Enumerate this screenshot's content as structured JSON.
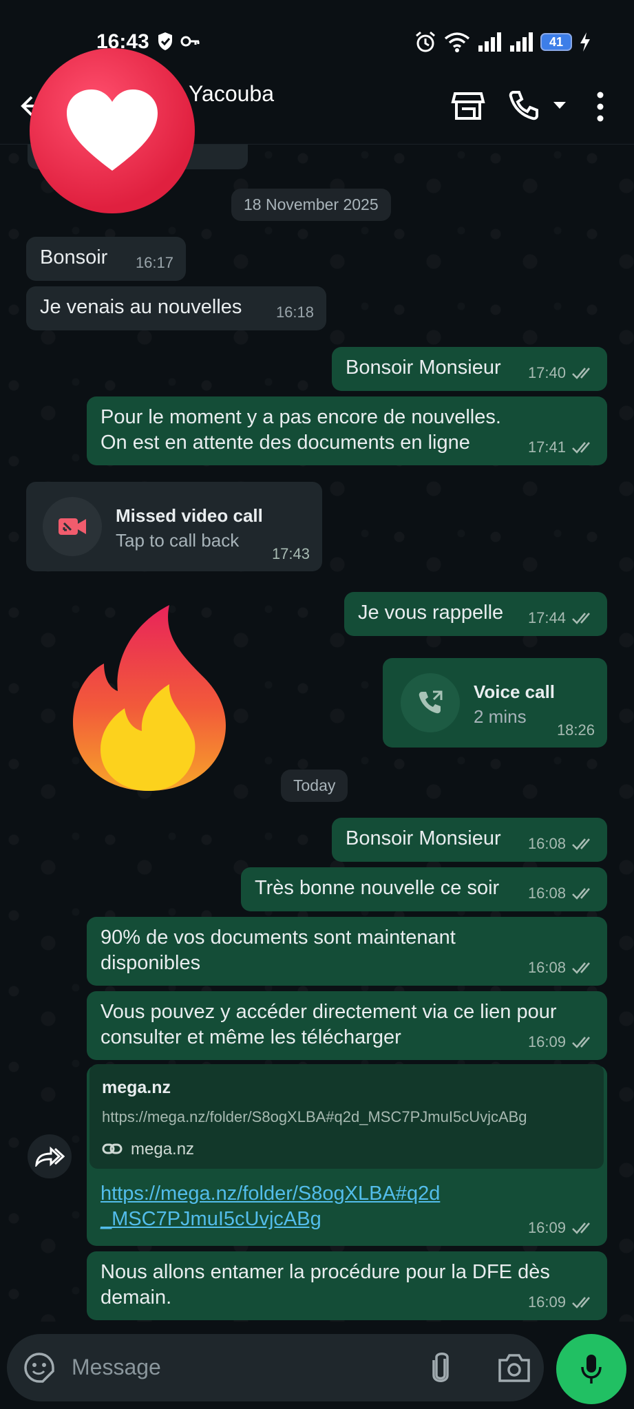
{
  "status": {
    "time": "16:43",
    "battery": "41"
  },
  "header": {
    "contact_name": "Fando Yacouba"
  },
  "chat": {
    "date1": "18 November 2025",
    "date2": "Today",
    "messages": [
      {
        "text": "Bonsoir",
        "time": "16:17"
      },
      {
        "text": "Je venais au nouvelles",
        "time": "16:18"
      },
      {
        "text": "Bonsoir Monsieur",
        "time": "17:40"
      },
      {
        "text": "Pour le moment y a pas encore de nouvelles. On est en attente des documents en ligne",
        "time": "17:41"
      },
      {
        "title": "Missed video call",
        "sub": "Tap to call back",
        "time": "17:43"
      },
      {
        "text": "Je vous rappelle",
        "time": "17:44"
      },
      {
        "title": "Voice call",
        "sub": "2 mins",
        "time": "18:26"
      },
      {
        "text": "Bonsoir Monsieur",
        "time": "16:08"
      },
      {
        "text": "Très bonne nouvelle ce soir",
        "time": "16:08"
      },
      {
        "text": "90% de vos documents sont maintenant disponibles",
        "time": "16:08"
      },
      {
        "text": "Vous pouvez y accéder directement via ce lien pour consulter et même les télécharger",
        "time": "16:09"
      },
      {
        "link_title": "mega.nz",
        "link_url": "https://mega.nz/folder/S8ogXLBA#q2d_MSC7PJmuI5cUvjcABg",
        "link_domain": "mega.nz",
        "text_line1": "https://mega.nz/folder/S8ogXLBA#q2d",
        "text_line2": "_MSC7PJmuI5cUvjcABg",
        "time": "16:09"
      },
      {
        "text": "Nous allons entamer la procédure pour la DFE dès demain.",
        "time": "16:09"
      }
    ]
  },
  "input": {
    "placeholder": "Message"
  },
  "colors": {
    "incoming": "#1f272c",
    "outgoing": "#144d37",
    "accent": "#21c063",
    "link": "#53bdeb",
    "missed": "#f15c6d"
  }
}
